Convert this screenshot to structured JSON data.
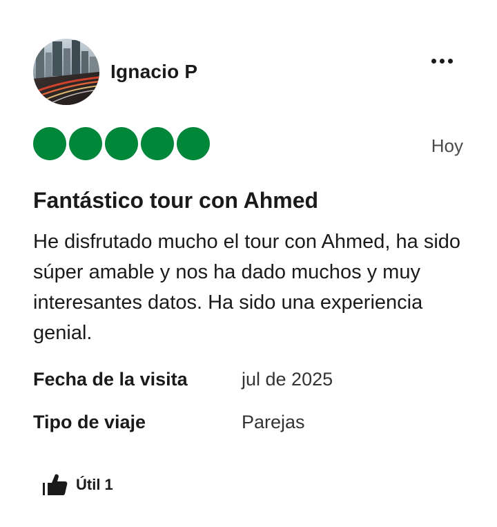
{
  "review": {
    "user": {
      "name": "Ignacio P"
    },
    "rating": {
      "value": 5,
      "max": 5
    },
    "date": "Hoy",
    "title": "Fantástico tour con Ahmed",
    "body": "He disfrutado mucho el tour con Ahmed, ha sido súper amable y nos ha dado muchos y muy interesantes datos. Ha sido una experiencia genial.",
    "details": [
      {
        "label": "Fecha de la visita",
        "value": "jul de 2025"
      },
      {
        "label": "Tipo de viaje",
        "value": "Parejas"
      }
    ],
    "helpful": {
      "label": "Útil 1"
    }
  },
  "colors": {
    "accent": "#00873a",
    "text": "#1a1a1a"
  },
  "icons": {
    "more": "more-horizontal-icon",
    "helpful": "thumbs-up-icon"
  }
}
